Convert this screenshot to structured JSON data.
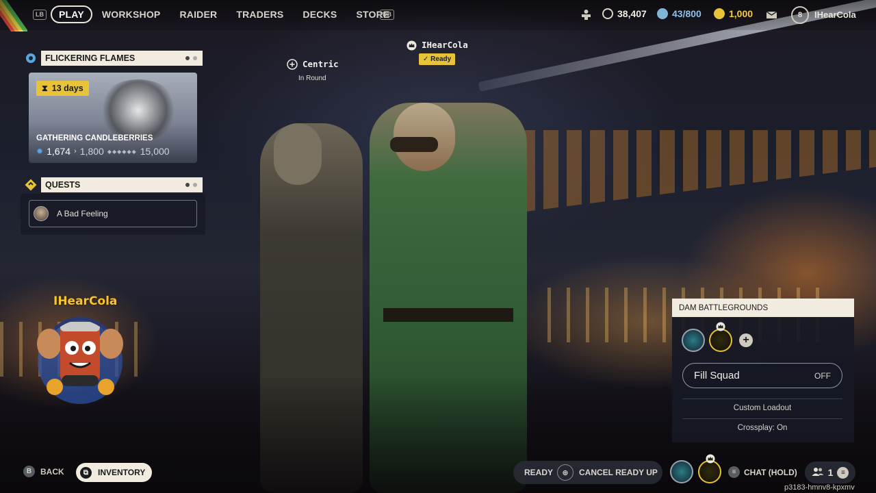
{
  "nav": {
    "lb": "LB",
    "rb": "RB",
    "items": [
      "PLAY",
      "WORKSHOP",
      "RAIDER",
      "TRADERS",
      "DECKS",
      "STORE"
    ],
    "active": "PLAY"
  },
  "currencies": {
    "coins": "38,407",
    "credits": "43/800",
    "tokens": "1,000"
  },
  "profile": {
    "level": "8",
    "username": "IHearCola"
  },
  "event": {
    "title": "FLICKERING FLAMES",
    "timer": "13 days",
    "name": "GATHERING CANDLEBERRIES",
    "current": "1,674",
    "next": "1,800",
    "max": "15,000"
  },
  "quests": {
    "title": "QUESTS",
    "items": [
      "A Bad Feeling"
    ]
  },
  "squad": {
    "leader_name": "IHearCola",
    "leader_status": "Ready",
    "member_name": "Centric",
    "member_status": "In Round"
  },
  "logo": {
    "text": "IHearCola"
  },
  "mode": {
    "title": "DAM BATTLEGROUNDS",
    "fill_squad_label": "Fill Squad",
    "fill_squad_value": "OFF",
    "custom_loadout": "Custom Loadout",
    "crossplay": "Crossplay: On"
  },
  "bottom": {
    "back_key": "B",
    "back_label": "BACK",
    "inventory_label": "INVENTORY",
    "ready_label": "READY",
    "cancel_label": "CANCEL READY UP",
    "chat_label": "CHAT (HOLD)",
    "party_count": "1",
    "session_id": "p3183-hmnv8-kpxmv"
  },
  "colors": {
    "accent_yellow": "#e8c337",
    "panel_cream": "#f1ecdf",
    "teal_avatar": "#2d7c86"
  }
}
